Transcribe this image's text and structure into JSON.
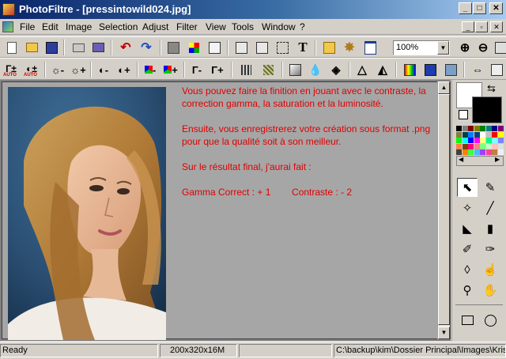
{
  "window": {
    "title": "PhotoFiltre - [pressintowild024.jpg]",
    "minimize": "_",
    "maximize": "□",
    "close": "✕"
  },
  "menu": {
    "items": [
      "File",
      "Edit",
      "Image",
      "Selection",
      "Adjust",
      "Filter",
      "View",
      "Tools",
      "Window",
      "?"
    ],
    "doc_controls": [
      "_",
      "▫",
      "✕"
    ]
  },
  "toolbar": {
    "zoom_value": "100%",
    "auto_label": "AUTO"
  },
  "document": {
    "lines": [
      "Vous pouvez faire la finition en jouant avec le contraste, la correction gamma, la saturation et la luminosité.",
      "Ensuite, vous enregistrerez votre création sous format .png pour que la qualité soit à son meilleur.",
      "Sur le résultat final, j'aurai fait :",
      "Gamma Correct : + 1        Contraste : - 2"
    ]
  },
  "palette": {
    "foreground": "#000000",
    "background": "#ffffff",
    "colors": [
      "#000000",
      "#808080",
      "#800000",
      "#808000",
      "#008000",
      "#008080",
      "#000080",
      "#800080",
      "#808040",
      "#004040",
      "#0080ff",
      "#004080",
      "#ffffff",
      "#c0c0c0",
      "#ff0000",
      "#ffff00",
      "#00ff00",
      "#00ffff",
      "#0000ff",
      "#ff00ff",
      "#ffff80",
      "#00ff80",
      "#80ffff",
      "#8080ff",
      "#ff8040",
      "#804000",
      "#ff0080",
      "#ff8080",
      "#80ff80",
      "#c0ffc0",
      "#ffc0c0",
      "#e0e0e0",
      "#404040",
      "#ff8000",
      "#40ff40",
      "#40c0ff",
      "#a040ff",
      "#ff40a0",
      "#c08040",
      "#f0f0f0"
    ]
  },
  "status": {
    "state": "Ready",
    "size": "200x320x16M",
    "path": "C:\\backup\\kim\\Dossier Principal\\Images\\Kristen"
  }
}
